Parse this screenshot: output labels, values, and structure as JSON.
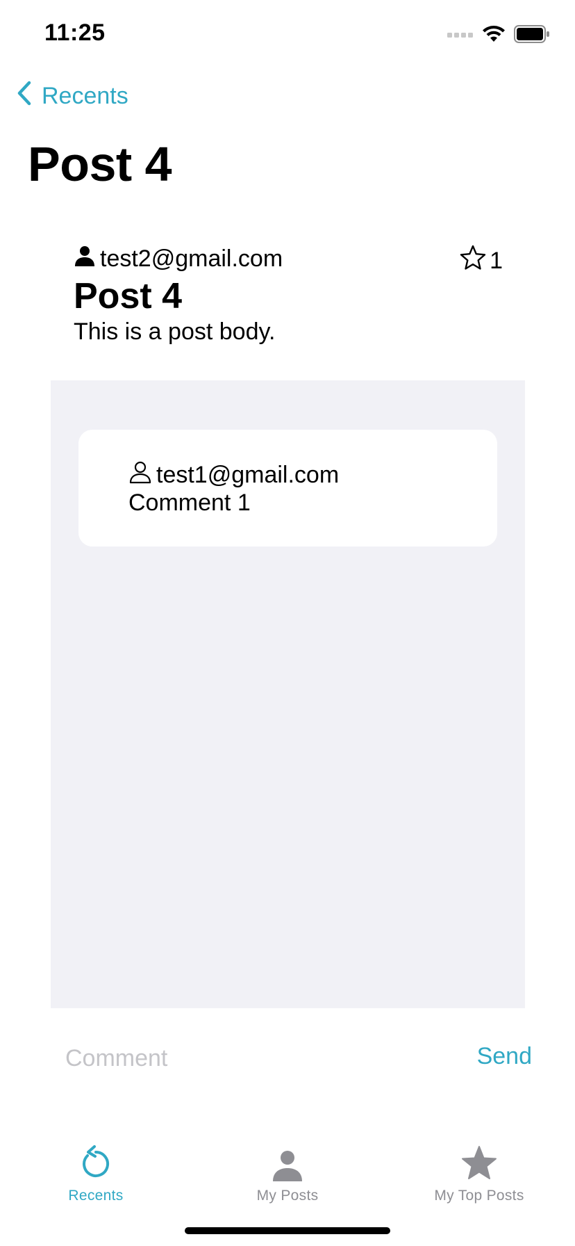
{
  "status_bar": {
    "time": "11:25"
  },
  "nav": {
    "back_label": "Recents",
    "large_title": "Post 4"
  },
  "post": {
    "author": "test2@gmail.com",
    "score": "1",
    "title": "Post 4",
    "body": "This is a post body."
  },
  "comments": [
    {
      "author": "test1@gmail.com",
      "text": "Comment 1"
    }
  ],
  "composer": {
    "placeholder": "Comment",
    "value": "",
    "send_label": "Send"
  },
  "tab_bar": {
    "tabs": [
      {
        "label": "Recents",
        "icon": "refresh-icon",
        "active": true
      },
      {
        "label": "My Posts",
        "icon": "person-fill-icon",
        "active": false
      },
      {
        "label": "My Top Posts",
        "icon": "star-fill-icon",
        "active": false
      }
    ]
  },
  "colors": {
    "accent": "#30a8c4",
    "comments_background": "#f1f1f6",
    "inactive_tab": "#8e8e93",
    "placeholder": "#c4c4c8"
  }
}
